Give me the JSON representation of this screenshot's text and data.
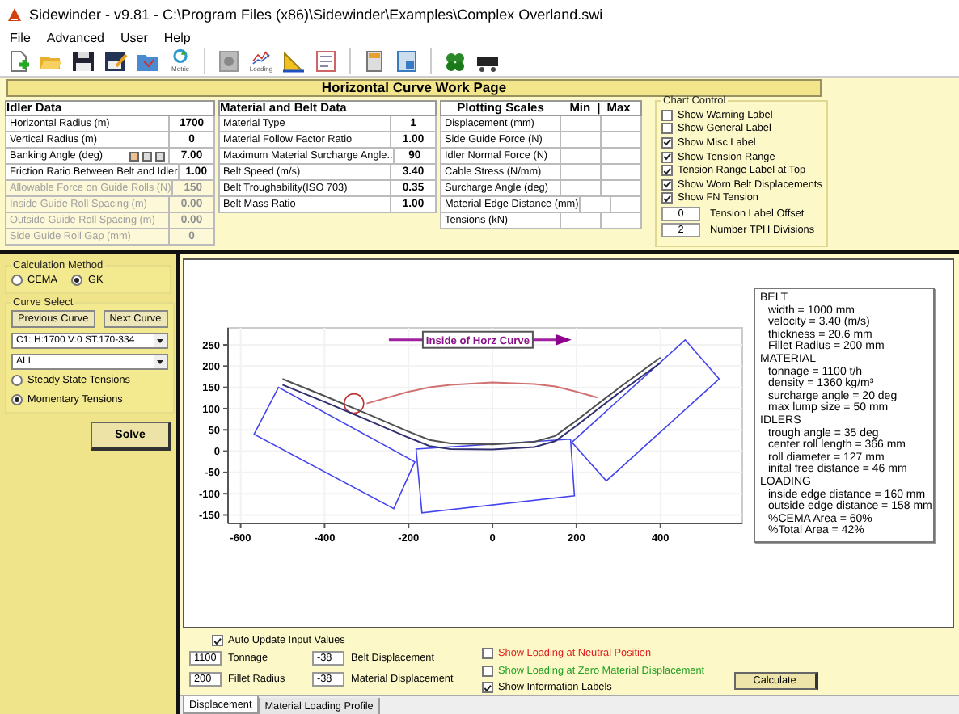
{
  "window": {
    "title": "Sidewinder - v9.81 - C:\\Program Files (x86)\\Sidewinder\\Examples\\Complex Overland.swi"
  },
  "menu": [
    "File",
    "Advanced",
    "User",
    "Help"
  ],
  "toolbar": [
    {
      "caption": "Metric"
    },
    {
      "caption": "Loading"
    }
  ],
  "page_title": "Horizontal Curve Work Page",
  "idler_data": {
    "title": "Idler Data",
    "rows": [
      {
        "label": "Horizontal Radius (m)",
        "value": "1700",
        "disabled": false,
        "has_buttons": false
      },
      {
        "label": "Vertical Radius (m)",
        "value": "0",
        "disabled": false,
        "has_buttons": false
      },
      {
        "label": "Banking Angle (deg)",
        "value": "7.00",
        "disabled": false,
        "has_buttons": true
      },
      {
        "label": "Friction Ratio Between Belt and Idler",
        "value": "1.00",
        "disabled": false,
        "has_buttons": false
      },
      {
        "label": "Allowable Force on Guide Rolls (N)",
        "value": "150",
        "disabled": true,
        "has_buttons": false
      },
      {
        "label": "Inside Guide Roll Spacing (m)",
        "value": "0.00",
        "disabled": true,
        "has_buttons": false
      },
      {
        "label": "Outside Guide Roll Spacing (m)",
        "value": "0.00",
        "disabled": true,
        "has_buttons": false
      },
      {
        "label": "Side Guide Roll Gap (mm)",
        "value": "0",
        "disabled": true,
        "has_buttons": false
      }
    ]
  },
  "material_belt_data": {
    "title": "Material and Belt Data",
    "rows": [
      {
        "label": "Material Type",
        "value": "1"
      },
      {
        "label": "Material Follow Factor Ratio",
        "value": "1.00"
      },
      {
        "label": "Maximum Material Surcharge Angle..",
        "value": "90"
      },
      {
        "label": "Belt Speed (m/s)",
        "value": "3.40"
      },
      {
        "label": "Belt Troughability(ISO 703)",
        "value": "0.35"
      },
      {
        "label": "Belt Mass Ratio",
        "value": "1.00"
      }
    ]
  },
  "plotting_scales": {
    "title": "Plotting Scales",
    "min_header": "Min",
    "separator": "|",
    "max_header": "Max",
    "rows": [
      "Displacement (mm)",
      "Side Guide Force (N)",
      "Idler Normal Force (N)",
      "Cable Stress (N/mm)",
      "Surcharge Angle (deg)",
      "Material Edge Distance (mm)",
      "Tensions (kN)"
    ]
  },
  "chart_control": {
    "title": "Chart Control",
    "checkboxes": [
      {
        "label": "Show Warning Label",
        "checked": false
      },
      {
        "label": "Show General Label",
        "checked": false
      },
      {
        "label": "Show Misc Label",
        "checked": true
      },
      {
        "label": "Show Tension Range",
        "checked": true
      },
      {
        "label": "Tension Range Label at Top",
        "checked": true
      },
      {
        "label": "Show Worn Belt Displacements",
        "checked": true
      },
      {
        "label": "Show FN Tension",
        "checked": true
      }
    ],
    "fields": [
      {
        "value": "0",
        "label": "Tension Label Offset"
      },
      {
        "value": "2",
        "label": "Number TPH Divisions"
      }
    ]
  },
  "calculation_method": {
    "title": "Calculation Method",
    "options": [
      {
        "label": "CEMA",
        "selected": false
      },
      {
        "label": "GK",
        "selected": true
      }
    ]
  },
  "curve_select": {
    "title": "Curve Select",
    "buttons": [
      "Previous Curve",
      "Next Curve"
    ],
    "selects": [
      "C1: H:1700 V:0 ST:170-334",
      "ALL"
    ],
    "tension_options": [
      {
        "label": "Steady State Tensions",
        "selected": false
      },
      {
        "label": "Momentary Tensions",
        "selected": true
      }
    ]
  },
  "solve_button": "Solve",
  "chart": {
    "chart_data": {
      "type": "line",
      "x": [
        -500,
        -400,
        -300,
        -200,
        -150,
        -100,
        0,
        100,
        150,
        200,
        250,
        300,
        400
      ],
      "series": [
        {
          "color": "#505050",
          "values": [
            170,
            130,
            88,
            46,
            26,
            18,
            16,
            22,
            36,
            72,
            110,
            148,
            220
          ]
        },
        {
          "color": "#303070",
          "values": [
            156,
            116,
            74,
            32,
            12,
            5,
            4,
            10,
            24,
            60,
            98,
            136,
            208
          ]
        },
        {
          "color": "#d07070",
          "values": [
            null,
            null,
            112,
            140,
            150,
            156,
            162,
            158,
            152,
            140,
            126,
            null,
            null
          ]
        }
      ],
      "xlim": [
        -630,
        595
      ],
      "ylim": [
        -170,
        290
      ],
      "xticks": [
        -600,
        -400,
        -200,
        0,
        200,
        400
      ],
      "yticks": [
        -150,
        -100,
        -50,
        0,
        50,
        100,
        150,
        200,
        250
      ],
      "grid": true,
      "annotations": [
        "Inside of Horz Curve"
      ]
    },
    "info_labels": [
      {
        "title": "BELT",
        "lines": [
          "width = 1000 mm",
          "velocity = 3.40 (m/s)",
          "thickness = 20.6 mm",
          "Fillet Radius = 200 mm"
        ]
      },
      {
        "title": "MATERIAL",
        "lines": [
          "tonnage = 1100 t/h",
          "density = 1360 kg/m³",
          "surcharge angle = 20 deg",
          "max lump size = 50 mm"
        ]
      },
      {
        "title": "IDLERS",
        "lines": [
          "trough angle = 35 deg",
          "center roll length = 366 mm",
          "roll diameter = 127 mm",
          "inital free distance = 46 mm"
        ]
      },
      {
        "title": "LOADING",
        "lines": [
          "inside edge distance = 160 mm",
          "outside edge distance = 158 mm",
          "%CEMA Area = 60%",
          "%Total Area = 42%"
        ]
      }
    ]
  },
  "options": {
    "auto_update": {
      "label": "Auto Update Input Values",
      "checked": true
    },
    "inputs": [
      {
        "value": "1100",
        "label": "Tonnage"
      },
      {
        "value": "200",
        "label": "Fillet Radius"
      },
      {
        "value": "-38",
        "label": "Belt Displacement"
      },
      {
        "value": "-38",
        "label": "Material Displacement"
      }
    ],
    "display_toggles": [
      {
        "label": "Show Loading at Neutral Position",
        "checked": false,
        "color": "#e02020"
      },
      {
        "label": "Show Loading at Zero Material Displacement",
        "checked": false,
        "color": "#20a020"
      },
      {
        "label": "Show Information Labels",
        "checked": true,
        "color": "#000000"
      }
    ],
    "calculate_button": "Calculate"
  },
  "tabs": [
    {
      "label": "Displacement",
      "selected": true
    },
    {
      "label": "Material Loading Profile",
      "selected": false
    }
  ]
}
